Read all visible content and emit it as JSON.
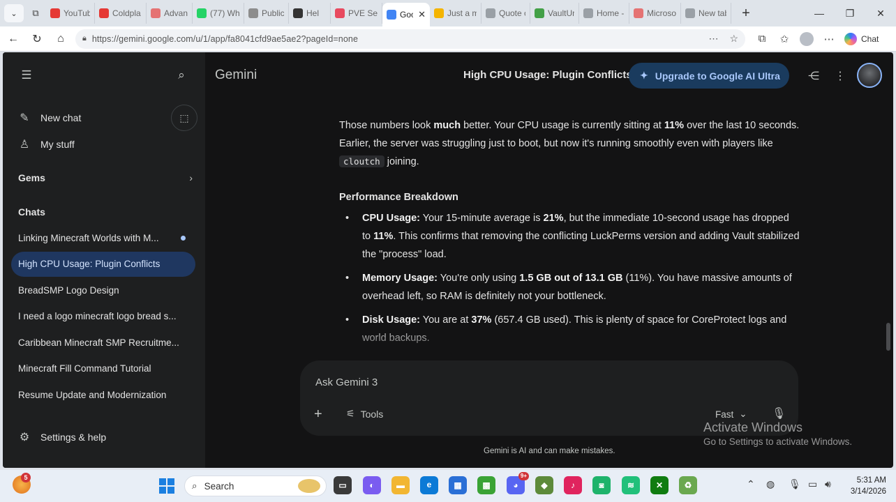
{
  "browser": {
    "tabs": [
      {
        "label": "YouTube",
        "icon": "youtube-icon",
        "color": "#e53935"
      },
      {
        "label": "Coldpla",
        "icon": "youtube-icon",
        "color": "#e53935"
      },
      {
        "label": "Advanc",
        "icon": "app-icon",
        "color": "#e57373"
      },
      {
        "label": "(77) Wh",
        "icon": "whatsapp-icon",
        "color": "#25d366"
      },
      {
        "label": "Public",
        "icon": "page-icon",
        "color": "#8d8d8d"
      },
      {
        "label": "Hel",
        "icon": "app-icon",
        "color": "#333333"
      },
      {
        "label": "PVE Ser",
        "icon": "app-icon",
        "color": "#e84a5f"
      },
      {
        "label": "Goo",
        "icon": "gemini-icon",
        "color": "#4285f4"
      },
      {
        "label": "Just a m",
        "icon": "cloud-icon",
        "color": "#f4b400"
      },
      {
        "label": "Quote c",
        "icon": "search-icon",
        "color": "#9aa0a6"
      },
      {
        "label": "VaultUn",
        "icon": "app-icon",
        "color": "#43a047"
      },
      {
        "label": "Home -",
        "icon": "drive-icon",
        "color": "#9aa0a6"
      },
      {
        "label": "Microso",
        "icon": "app-icon",
        "color": "#e57373"
      },
      {
        "label": "New tab",
        "icon": "page-icon",
        "color": "#9aa0a6"
      }
    ],
    "active_tab_index": 7,
    "url": "https://gemini.google.com/u/1/app/fa8041cfd9ae5ae2?pageId=none",
    "copilot_label": "Chat"
  },
  "sidebar": {
    "new_chat": "New chat",
    "my_stuff": "My stuff",
    "gems": "Gems",
    "chats_heading": "Chats",
    "chats": [
      {
        "label": "Linking Minecraft Worlds with M...",
        "unread": true
      },
      {
        "label": "High CPU Usage: Plugin Conflicts",
        "active": true
      },
      {
        "label": "BreadSMP Logo Design"
      },
      {
        "label": "I need a logo minecraft logo bread s..."
      },
      {
        "label": "Caribbean Minecraft SMP Recruitme..."
      },
      {
        "label": "Minecraft Fill Command Tutorial"
      },
      {
        "label": "Resume Update and Modernization"
      }
    ],
    "settings": "Settings & help"
  },
  "header": {
    "app_name": "Gemini",
    "conversation_title": "High CPU Usage: Plugin Conflicts",
    "upgrade_label": "Upgrade to Google AI Ultra"
  },
  "response": {
    "intro_1": "Those numbers look ",
    "intro_b1": "much",
    "intro_2": " better. Your CPU usage is currently sitting at ",
    "intro_b2": "11%",
    "intro_3": " over the last 10 seconds. Earlier, the server was struggling just to boot, but now it's running smoothly even with players like ",
    "intro_code": "cloutch",
    "intro_4": " joining.",
    "heading": "Performance Breakdown",
    "bullets": {
      "cpu_label": "CPU Usage:",
      "cpu_1": " Your 15-minute average is ",
      "cpu_b1": "21%",
      "cpu_2": ", but the immediate 10-second usage has dropped to ",
      "cpu_b2": "11%",
      "cpu_3": ". This confirms that removing the conflicting LuckPerms version and adding Vault stabilized the \"process\" load.",
      "mem_label": "Memory Usage:",
      "mem_1": " You're only using ",
      "mem_b1": "1.5 GB out of 13.1 GB",
      "mem_2": " (11%). You have massive amounts of overhead left, so RAM is definitely not your bottleneck.",
      "disk_label": "Disk Usage:",
      "disk_1": " You are at ",
      "disk_b1": "37%",
      "disk_2": " (657.4 GB used). This is plenty of space for CoreProtect logs and world backups."
    }
  },
  "composer": {
    "placeholder": "Ask Gemini 3",
    "tools_label": "Tools",
    "mode_label": "Fast"
  },
  "disclaimer": "Gemini is AI and can make mistakes.",
  "watermark": {
    "line1": "Activate Windows",
    "line2": "Go to Settings to activate Windows."
  },
  "taskbar": {
    "weather_badge": "5",
    "search_label": "Search",
    "discord_badge": "9+",
    "time": "5:31 AM",
    "date": "3/14/2026"
  },
  "colors": {
    "app_bg": "#131314",
    "sidebar_bg": "#1e1f20",
    "active_chat": "#1f3760",
    "upgrade_bg": "#1a3b5e",
    "accent": "#a8c7fa"
  }
}
